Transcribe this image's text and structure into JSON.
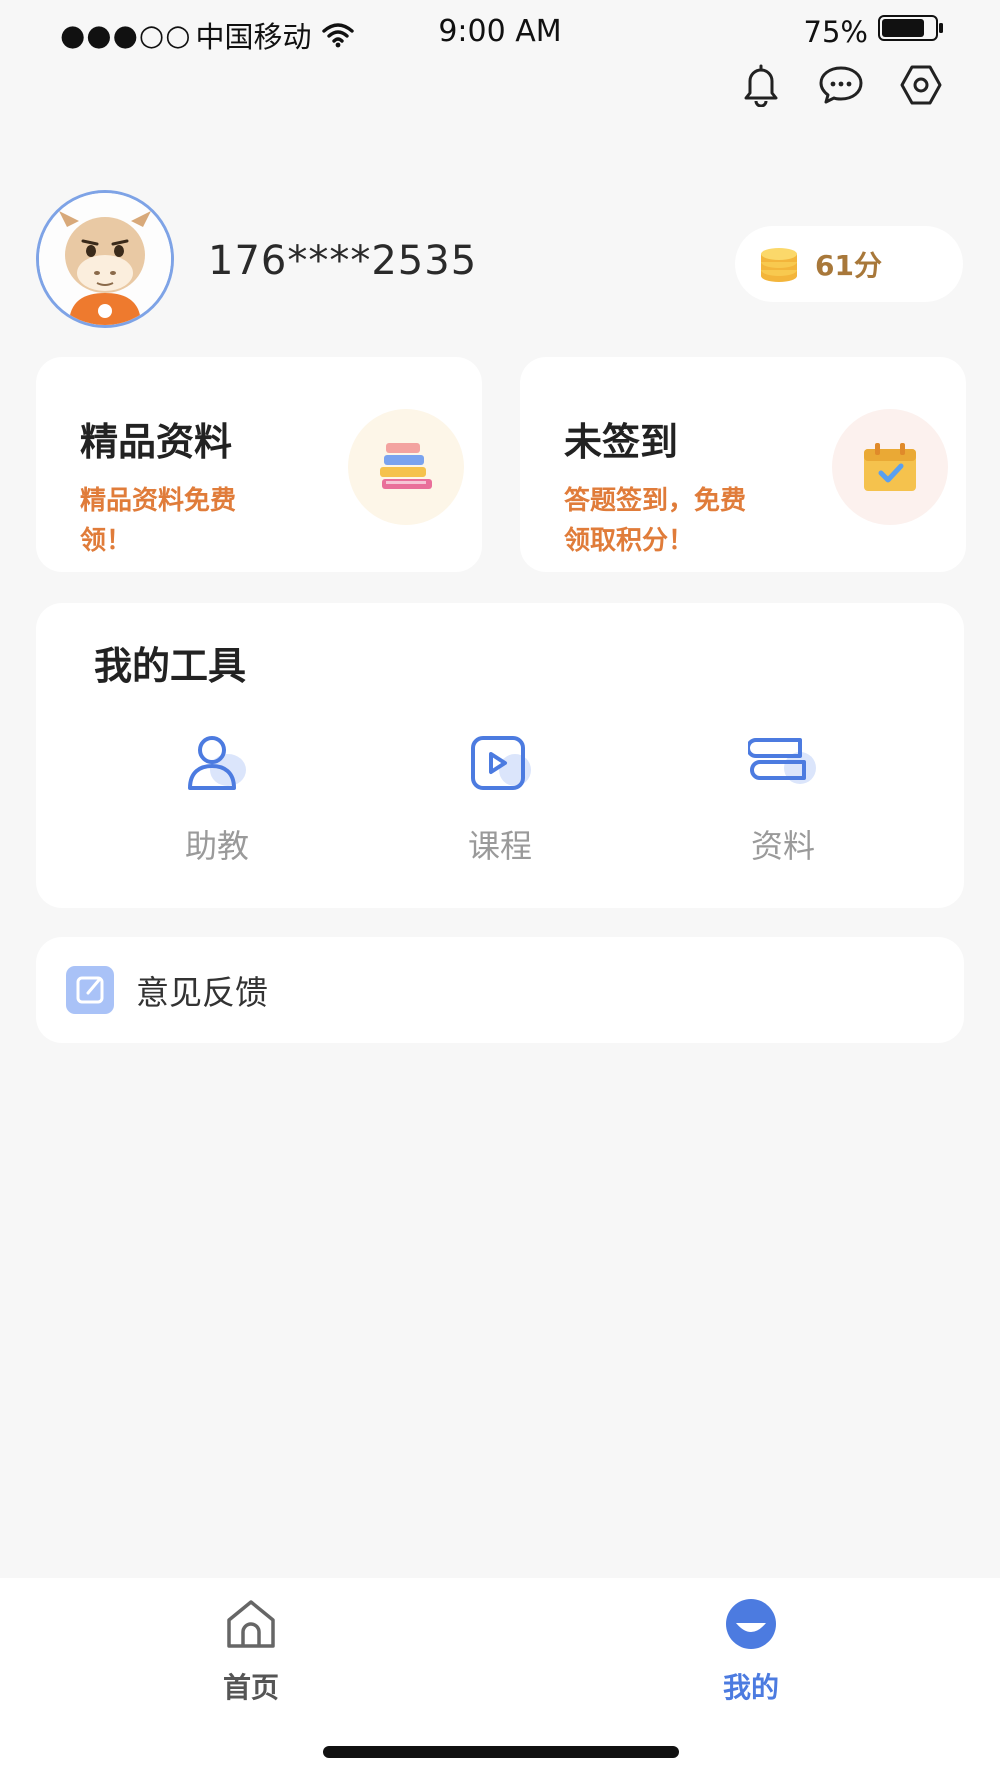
{
  "status_bar": {
    "carrier": "中国移动",
    "signal_dots": "●●●○○",
    "time": "9:00 AM",
    "battery": "75%"
  },
  "header_icons": [
    "bell-icon",
    "message-icon",
    "settings-icon"
  ],
  "profile": {
    "username": "176****2535",
    "points": "61分"
  },
  "cards": {
    "premium": {
      "title": "精品资料",
      "subtitle": "精品资料免费领！",
      "icon": "books-icon"
    },
    "checkin": {
      "title": "未签到",
      "subtitle": "答题签到，免费领取积分！",
      "icon": "calendar-check-icon"
    }
  },
  "tools": {
    "title": "我的工具",
    "items": [
      {
        "label": "助教",
        "icon": "assistant-icon"
      },
      {
        "label": "课程",
        "icon": "course-icon"
      },
      {
        "label": "资料",
        "icon": "materials-icon"
      }
    ]
  },
  "feedback": {
    "label": "意见反馈",
    "icon": "edit-icon"
  },
  "tab_bar": {
    "items": [
      {
        "label": "首页",
        "icon": "home-icon",
        "active": false
      },
      {
        "label": "我的",
        "icon": "profile-icon",
        "active": true
      }
    ]
  },
  "colors": {
    "accent_blue": "#4c7be0",
    "orange": "#e07c3a",
    "points_gold": "#a8783a",
    "background": "#f7f7f7"
  }
}
